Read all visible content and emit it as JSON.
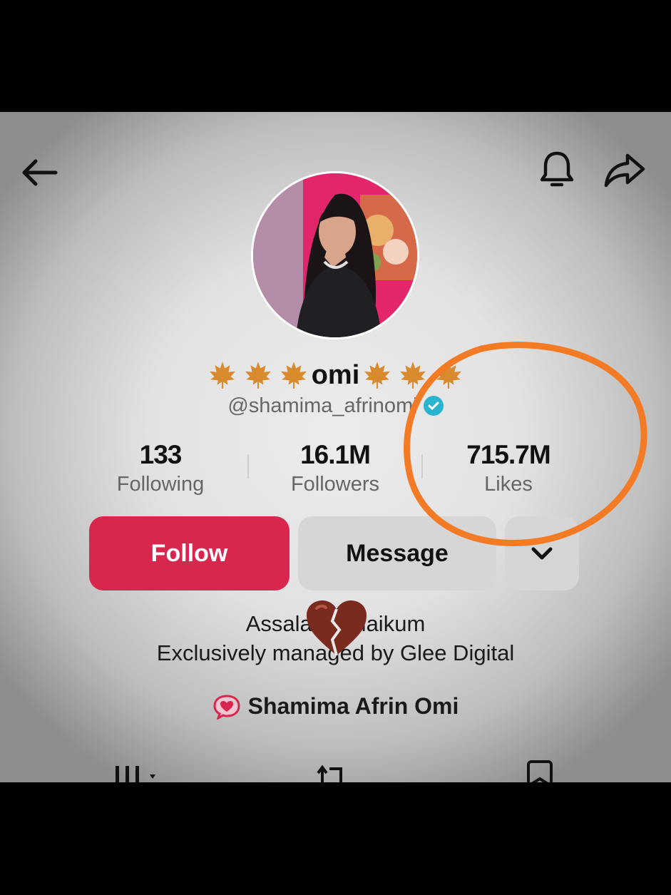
{
  "profile": {
    "display_name": "omi",
    "handle": "@shamima_afrinomi"
  },
  "stats": [
    {
      "value": "133",
      "label": "Following"
    },
    {
      "value": "16.1M",
      "label": "Followers"
    },
    {
      "value": "715.7M",
      "label": "Likes"
    }
  ],
  "actions": {
    "follow_label": "Follow",
    "message_label": "Message"
  },
  "bio": {
    "line1": "Assalamu alaikum",
    "line2": "Exclusively managed by Glee Digital"
  },
  "link": {
    "label": "Shamima Afrin Omi"
  },
  "icons": {
    "back": "arrow-left-icon",
    "bell": "bell-icon",
    "share": "share-icon",
    "verified": "verified-badge-icon",
    "leaf": "maple-leaf-icon",
    "heart": "broken-heart-icon",
    "link": "chat-heart-icon",
    "tab_videos": "videos-grid-icon",
    "tab_reposts": "repost-icon",
    "tab_favorites": "bookmark-icon"
  },
  "colors": {
    "follow": "#d8274e",
    "verified": "#2bb4cf",
    "annotation": "#f47b26"
  }
}
